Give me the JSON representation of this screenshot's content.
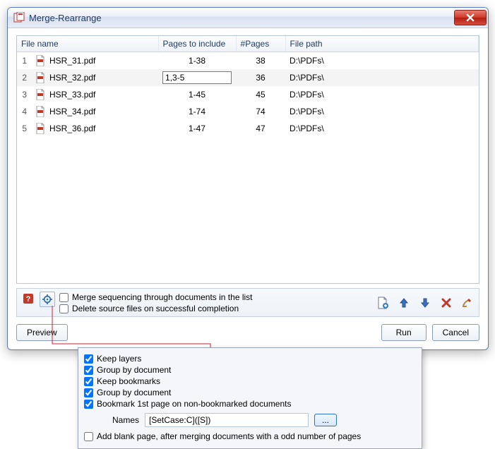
{
  "window": {
    "title": "Merge-Rearrange"
  },
  "table": {
    "headers": {
      "name": "File name",
      "pages": "Pages to include",
      "npages": "#Pages",
      "path": "File path"
    },
    "rows": [
      {
        "idx": "1",
        "name": "HSR_31.pdf",
        "pages": "1-38",
        "npages": "38",
        "path": "D:\\PDFs\\",
        "editing": false
      },
      {
        "idx": "2",
        "name": "HSR_32.pdf",
        "pages": "1,3-5",
        "npages": "36",
        "path": "D:\\PDFs\\",
        "editing": true
      },
      {
        "idx": "3",
        "name": "HSR_33.pdf",
        "pages": "1-45",
        "npages": "45",
        "path": "D:\\PDFs\\",
        "editing": false
      },
      {
        "idx": "4",
        "name": "HSR_34.pdf",
        "pages": "1-74",
        "npages": "74",
        "path": "D:\\PDFs\\",
        "editing": false
      },
      {
        "idx": "5",
        "name": "HSR_36.pdf",
        "pages": "1-47",
        "npages": "47",
        "path": "D:\\PDFs\\",
        "editing": false
      }
    ]
  },
  "options": {
    "merge_seq": "Merge sequencing through documents in the list",
    "delete_src": "Delete source files on successful completion"
  },
  "buttons": {
    "preview": "Preview",
    "run": "Run",
    "cancel": "Cancel"
  },
  "popup": {
    "keep_layers": "Keep layers",
    "group_doc1": "Group by document",
    "keep_bookmarks": "Keep bookmarks",
    "group_doc2": "Group by document",
    "bookmark_first": "Bookmark 1st page on non-bookmarked documents",
    "names_label": "Names",
    "names_value": "[SetCase:C]([S])",
    "browse": "...",
    "add_blank": "Add blank page, after merging documents with a odd number of pages"
  }
}
